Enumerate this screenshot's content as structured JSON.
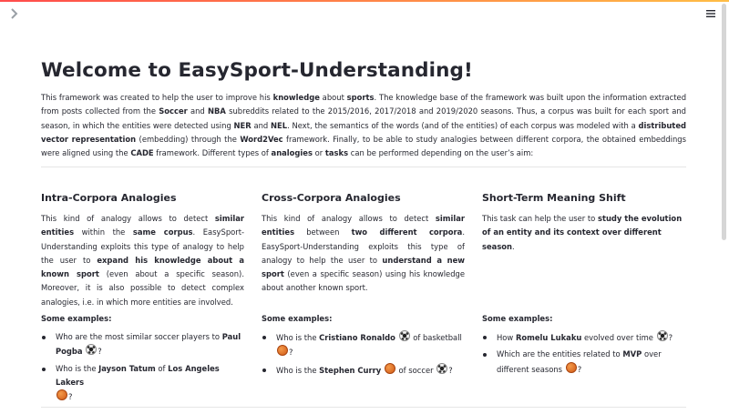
{
  "app": {
    "title": "Welcome to EasySport-Understanding!"
  },
  "icons": {
    "sidebar_toggle": "chevron-right-icon",
    "menu": "hamburger-icon",
    "soccer": "soccer-ball-icon",
    "basketball": "basketball-icon"
  },
  "colors": {
    "accent_start": "#ff4b4b",
    "accent_end": "#ffbd45",
    "text": "#262730"
  },
  "intro": {
    "t1": "This framework was created to help the user to improve his ",
    "b1": "knowledge",
    "t2": " about ",
    "b2": "sports",
    "t3": ". The knowledge base of the framework was built upon the information extracted from posts collected from the ",
    "b3": "Soccer",
    "t4": " and ",
    "b4": "NBA",
    "t5": " subreddits related to the 2015/2016, 2017/2018 and 2019/2020 seasons. Thus, a corpus was built for each sport and season, in which the entities were detected using ",
    "b5": "NER",
    "t6": " and ",
    "b6": "NEL",
    "t7": ". Next, the semantics of the words (and of the entities) of each corpus was modeled with a ",
    "b7": "distributed vector representation",
    "t8": " (embedding) through the ",
    "b8": "Word2Vec",
    "t9": " framework. Finally, to be able to study analogies between different corpora, the obtained embeddings were aligned using the ",
    "b9": "CADE",
    "t10": " framework. Different types of ",
    "b10": "analogies",
    "t11": " or ",
    "b11": "tasks",
    "t12": " can be performed depending on the user’s aim:"
  },
  "columns": [
    {
      "title": "Intra-Corpora Analogies",
      "d": {
        "t1": "This kind of analogy allows to detect ",
        "b1": "similar entities",
        "t2": " within the ",
        "b2": "same corpus",
        "t3": ". EasySport-Understanding exploits this type of analogy to help the user to ",
        "b3": "expand his knowledge about a known sport",
        "t4": " (even about a specific season). Moreover, it is also possible to detect complex analogies, i.e. in which more entities are involved."
      },
      "examples_title": "Some examples:",
      "examples": [
        {
          "t1": "Who are the most similar soccer players to ",
          "b1": "Paul Pogba",
          "t2": "?"
        },
        {
          "t1": "Who is the ",
          "b1": "Jayson Tatum",
          "t2": " of ",
          "b2": "Los Angeles Lakers",
          "t3": "?"
        }
      ]
    },
    {
      "title": "Cross-Corpora Analogies",
      "d": {
        "t1": "This kind of analogy allows to detect ",
        "b1": "similar entities",
        "t2": " between ",
        "b2": "two different corpora",
        "t3": ". EasySport-Understanding exploits this type of analogy to help the user to ",
        "b3": "understand a new sport",
        "t4": " (even a specific season) using his knowledge about another known sport."
      },
      "examples_title": "Some examples:",
      "examples": [
        {
          "t1": "Who is the ",
          "b1": "Cristiano Ronaldo",
          "t2": " of basketball ",
          "t3": "?"
        },
        {
          "t1": "Who is the ",
          "b1": "Stephen Curry",
          "t2": " of soccer ",
          "t3": "?"
        }
      ]
    },
    {
      "title": "Short-Term Meaning Shift",
      "d": {
        "t1": "This task can help the user to ",
        "b1": "study the evolution of an entity and its context over different season",
        "t2": "."
      },
      "examples_title": "Some examples:",
      "examples": [
        {
          "t1": "How ",
          "b1": "Romelu Lukaku",
          "t2": " evolved over time ",
          "t3": "?"
        },
        {
          "t1": "Which are the entities related to ",
          "b1": "MVP",
          "t2": " over different seasons ",
          "t3": "?"
        }
      ]
    }
  ]
}
